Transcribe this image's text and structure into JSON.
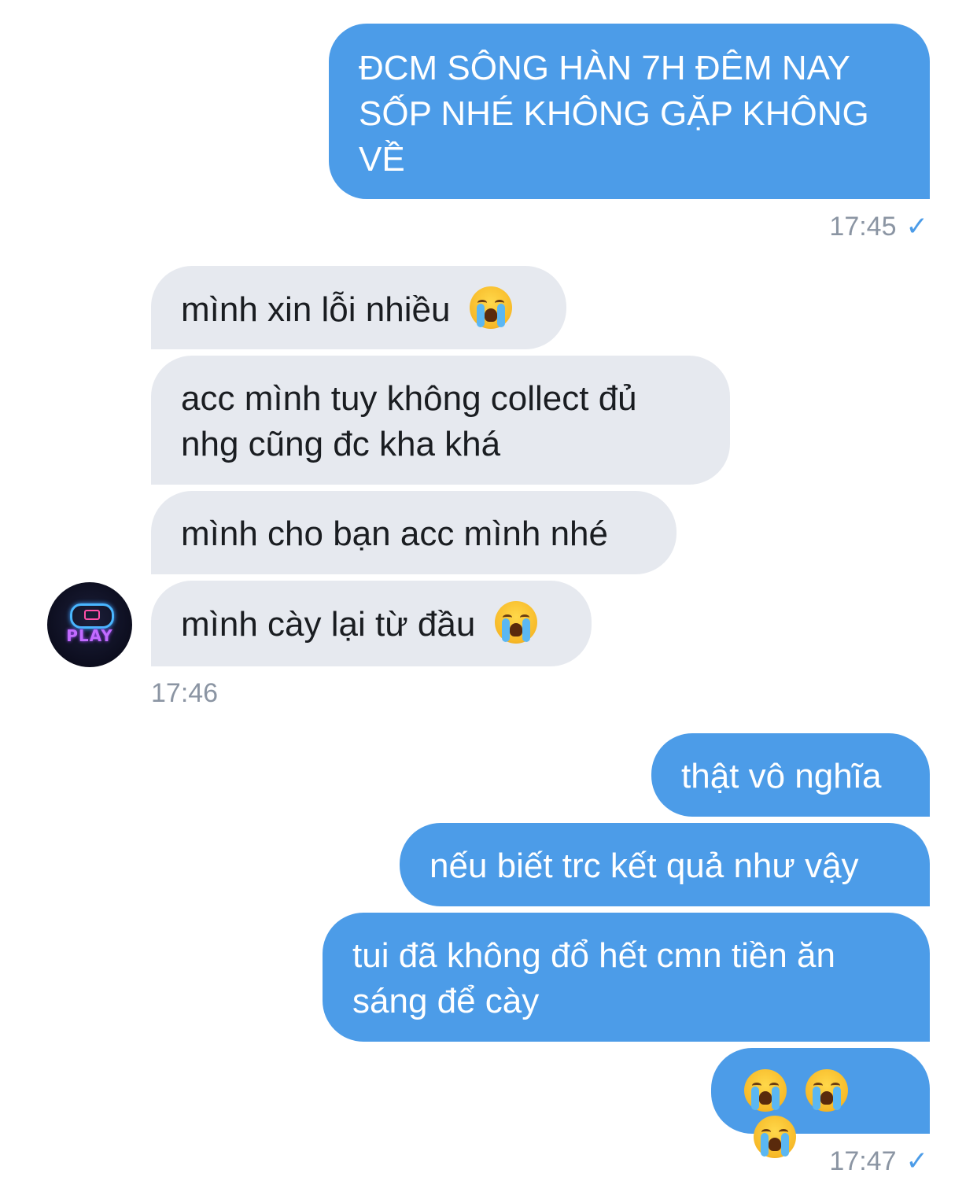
{
  "messages": {
    "m1": "ĐCM SÔNG HÀN 7H ĐÊM NAY SỐP NHÉ KHÔNG GẶP KHÔNG VỀ",
    "m2": "mình xin lỗi nhiều",
    "m3": "acc mình tuy không collect đủ nhg cũng đc kha khá",
    "m4": "mình cho bạn acc mình nhé",
    "m5": "mình cày lại từ đầu",
    "m6": "thật vô nghĩa",
    "m7": "nếu biết trc kết quả như vậy",
    "m8": "tui đã không đổ hết cmn tiền ăn sáng để cày"
  },
  "timestamps": {
    "t1": "17:45",
    "t2": "17:46",
    "t3": "17:47"
  },
  "read_mark": "✓",
  "avatar": {
    "label": "PLAY"
  },
  "icons": {
    "emoji": "loudly-crying-face-icon",
    "status": "check-icon",
    "avatar_graphic": "gamepad-icon"
  },
  "colors": {
    "outgoing_bubble": "#4c9ce8",
    "incoming_bubble": "#e6e9ef",
    "timestamp": "#8b95a3",
    "check": "#4c9ce8"
  }
}
